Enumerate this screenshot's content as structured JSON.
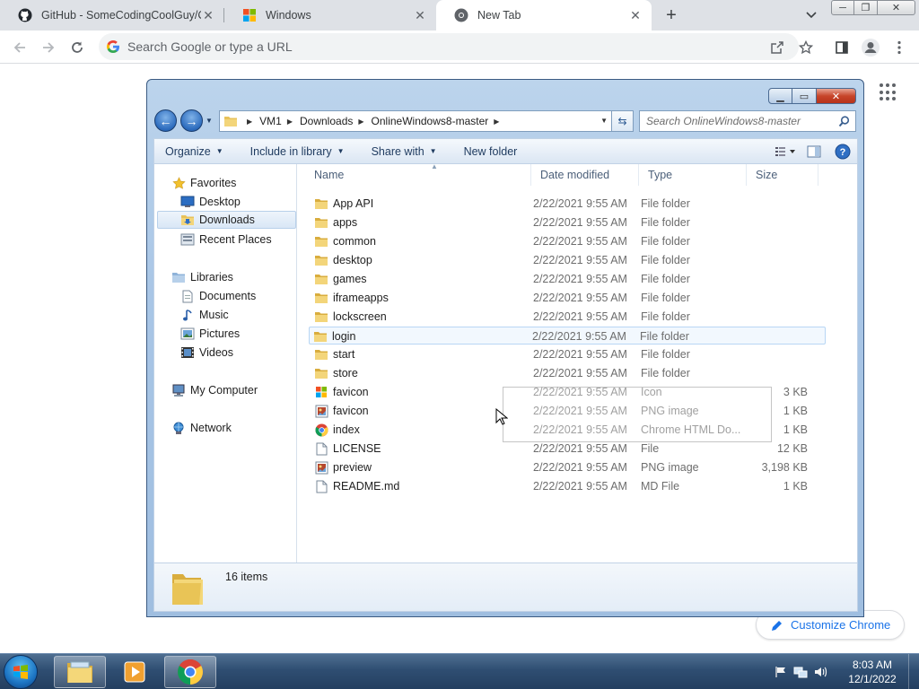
{
  "browser": {
    "tabs": [
      {
        "title": "GitHub - SomeCodingCoolGuy/C",
        "favicon": "github-icon",
        "active": false
      },
      {
        "title": "Windows",
        "favicon": "windows-logo-icon",
        "active": false
      },
      {
        "title": "New Tab",
        "favicon": "chrome-icon",
        "active": true
      }
    ],
    "omnibox": {
      "placeholder": "Search Google or type a URL",
      "value": ""
    },
    "customize_label": "Customize Chrome",
    "accent": "#1a73e8"
  },
  "explorer": {
    "breadcrumbs": [
      "VM1",
      "Downloads",
      "OnlineWindows8-master"
    ],
    "search_placeholder": "Search OnlineWindows8-master",
    "commands": [
      "Organize",
      "Include in library",
      "Share with",
      "New folder"
    ],
    "nav": {
      "favorites_label": "Favorites",
      "favorites": [
        "Desktop",
        "Downloads",
        "Recent Places"
      ],
      "selected": "Downloads",
      "libraries_label": "Libraries",
      "libraries": [
        "Documents",
        "Music",
        "Pictures",
        "Videos"
      ],
      "computer_label": "My Computer",
      "network_label": "Network"
    },
    "columns": [
      "Name",
      "Date modified",
      "Type",
      "Size"
    ],
    "files": [
      {
        "name": "App API",
        "date": "2/22/2021 9:55 AM",
        "type": "File folder",
        "size": "",
        "icon": "folder-icon"
      },
      {
        "name": "apps",
        "date": "2/22/2021 9:55 AM",
        "type": "File folder",
        "size": "",
        "icon": "folder-icon"
      },
      {
        "name": "common",
        "date": "2/22/2021 9:55 AM",
        "type": "File folder",
        "size": "",
        "icon": "folder-icon"
      },
      {
        "name": "desktop",
        "date": "2/22/2021 9:55 AM",
        "type": "File folder",
        "size": "",
        "icon": "folder-icon"
      },
      {
        "name": "games",
        "date": "2/22/2021 9:55 AM",
        "type": "File folder",
        "size": "",
        "icon": "folder-icon"
      },
      {
        "name": "iframeapps",
        "date": "2/22/2021 9:55 AM",
        "type": "File folder",
        "size": "",
        "icon": "folder-icon"
      },
      {
        "name": "lockscreen",
        "date": "2/22/2021 9:55 AM",
        "type": "File folder",
        "size": "",
        "icon": "folder-icon"
      },
      {
        "name": "login",
        "date": "2/22/2021 9:55 AM",
        "type": "File folder",
        "size": "",
        "icon": "folder-icon"
      },
      {
        "name": "start",
        "date": "2/22/2021 9:55 AM",
        "type": "File folder",
        "size": "",
        "icon": "folder-icon"
      },
      {
        "name": "store",
        "date": "2/22/2021 9:55 AM",
        "type": "File folder",
        "size": "",
        "icon": "folder-icon"
      },
      {
        "name": "favicon",
        "date": "2/22/2021 9:55 AM",
        "type": "Icon",
        "size": "3 KB",
        "icon": "windows-icon-file-icon"
      },
      {
        "name": "favicon",
        "date": "2/22/2021 9:55 AM",
        "type": "PNG image",
        "size": "1 KB",
        "icon": "image-file-icon"
      },
      {
        "name": "index",
        "date": "2/22/2021 9:55 AM",
        "type": "Chrome HTML Do...",
        "size": "1 KB",
        "icon": "chrome-html-icon"
      },
      {
        "name": "LICENSE",
        "date": "2/22/2021 9:55 AM",
        "type": "File",
        "size": "12 KB",
        "icon": "blank-file-icon"
      },
      {
        "name": "preview",
        "date": "2/22/2021 9:55 AM",
        "type": "PNG image",
        "size": "3,198 KB",
        "icon": "image-file-icon"
      },
      {
        "name": "README.md",
        "date": "2/22/2021 9:55 AM",
        "type": "MD File",
        "size": "1 KB",
        "icon": "blank-file-icon"
      }
    ],
    "hovered_row": "login",
    "status_count": "16 items"
  },
  "taskbar": {
    "time": "8:03 AM",
    "date": "12/1/2022"
  }
}
